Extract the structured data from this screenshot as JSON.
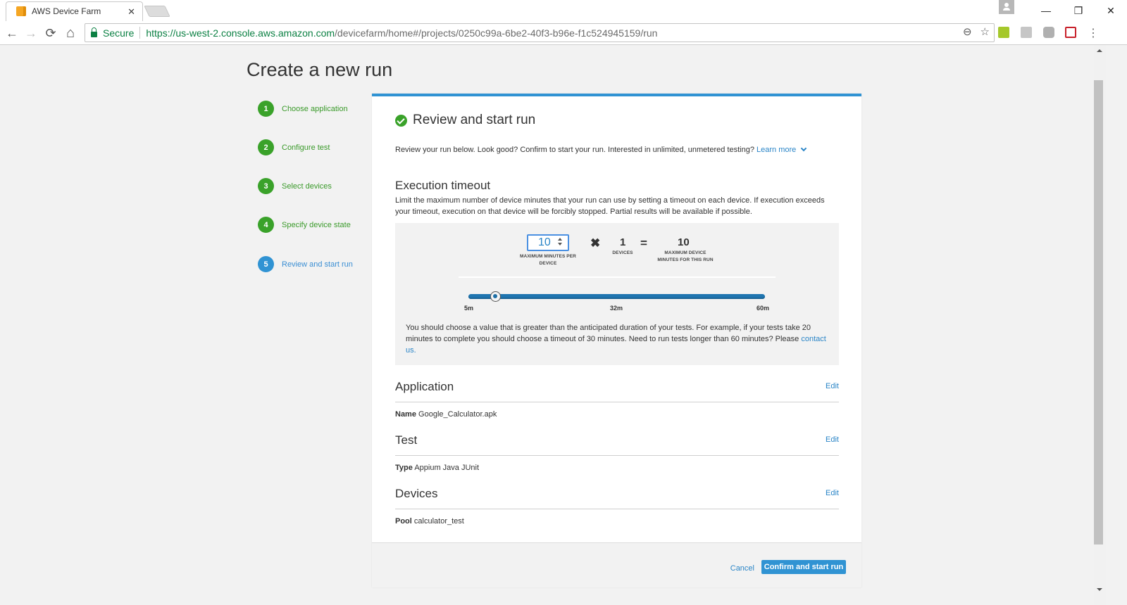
{
  "browser": {
    "tab_title": "AWS Device Farm",
    "secure_label": "Secure",
    "url_host": "https://us-west-2.console.aws.amazon.com",
    "url_path": "/devicefarm/home#/projects/0250c99a-6be2-40f3-b96e-f1c524945159/run",
    "icons": {
      "back": "←",
      "forward": "→",
      "reload": "⟳",
      "home": "⌂",
      "zoom": "⊖",
      "bookmark": "☆",
      "menu": "⋮",
      "minimize": "—",
      "restore": "❐",
      "close": "✕",
      "tab_close": "✕"
    },
    "extensions": [
      {
        "name": "extension-green",
        "color": "#a5c82b"
      },
      {
        "name": "extension-download",
        "color": "#c6c6c6"
      },
      {
        "name": "extension-gray",
        "color": "#b0b0b0"
      },
      {
        "name": "extension-red",
        "color": "#c8202a"
      }
    ]
  },
  "page": {
    "title": "Create a new run"
  },
  "steps": [
    {
      "number": "1",
      "label": "Choose application",
      "state": "done"
    },
    {
      "number": "2",
      "label": "Configure test",
      "state": "done"
    },
    {
      "number": "3",
      "label": "Select devices",
      "state": "done"
    },
    {
      "number": "4",
      "label": "Specify device state",
      "state": "done"
    },
    {
      "number": "5",
      "label": "Review and start run",
      "state": "active"
    }
  ],
  "review": {
    "title": "Review and start run",
    "intro": "Review your run below. Look good? Confirm to start your run. Interested in unlimited, unmetered testing?",
    "learn_more": "Learn more"
  },
  "execution": {
    "title": "Execution timeout",
    "description": "Limit the maximum number of device minutes that your run can use by setting a timeout on each device. If execution exceeds your timeout, execution on that device will be forcibly stopped. Partial results will be available if possible.",
    "minutes_per_device": "10",
    "minutes_per_device_caption": "MAXIMUM MINUTES PER DEVICE",
    "times_symbol": "✖",
    "devices": "1",
    "devices_caption": "DEVICES",
    "equals_symbol": "=",
    "total_minutes": "10",
    "total_caption": "MAXIMUM DEVICE MINUTES FOR THIS RUN",
    "slider": {
      "min": 5,
      "max": 60,
      "value": 10
    },
    "slider_ticks": [
      "5m",
      "32m",
      "60m"
    ],
    "hint": "You should choose a value that is greater than the anticipated duration of your tests. For example, if your tests take 20 minutes to complete you should choose a timeout of 30 minutes. Need to run tests longer than 60 minutes? Please",
    "contact_link": "contact us."
  },
  "sections": {
    "application": {
      "title": "Application",
      "edit": "Edit",
      "key": "Name",
      "value": "Google_Calculator.apk"
    },
    "test": {
      "title": "Test",
      "edit": "Edit",
      "key": "Type",
      "value": "Appium Java JUnit"
    },
    "devices": {
      "title": "Devices",
      "edit": "Edit",
      "key": "Pool",
      "value": "calculator_test"
    }
  },
  "footer": {
    "cancel": "Cancel",
    "confirm": "Confirm and start run"
  },
  "colors": {
    "accent": "#3093d3",
    "success": "#3aa22a",
    "link": "#2a85c7"
  }
}
